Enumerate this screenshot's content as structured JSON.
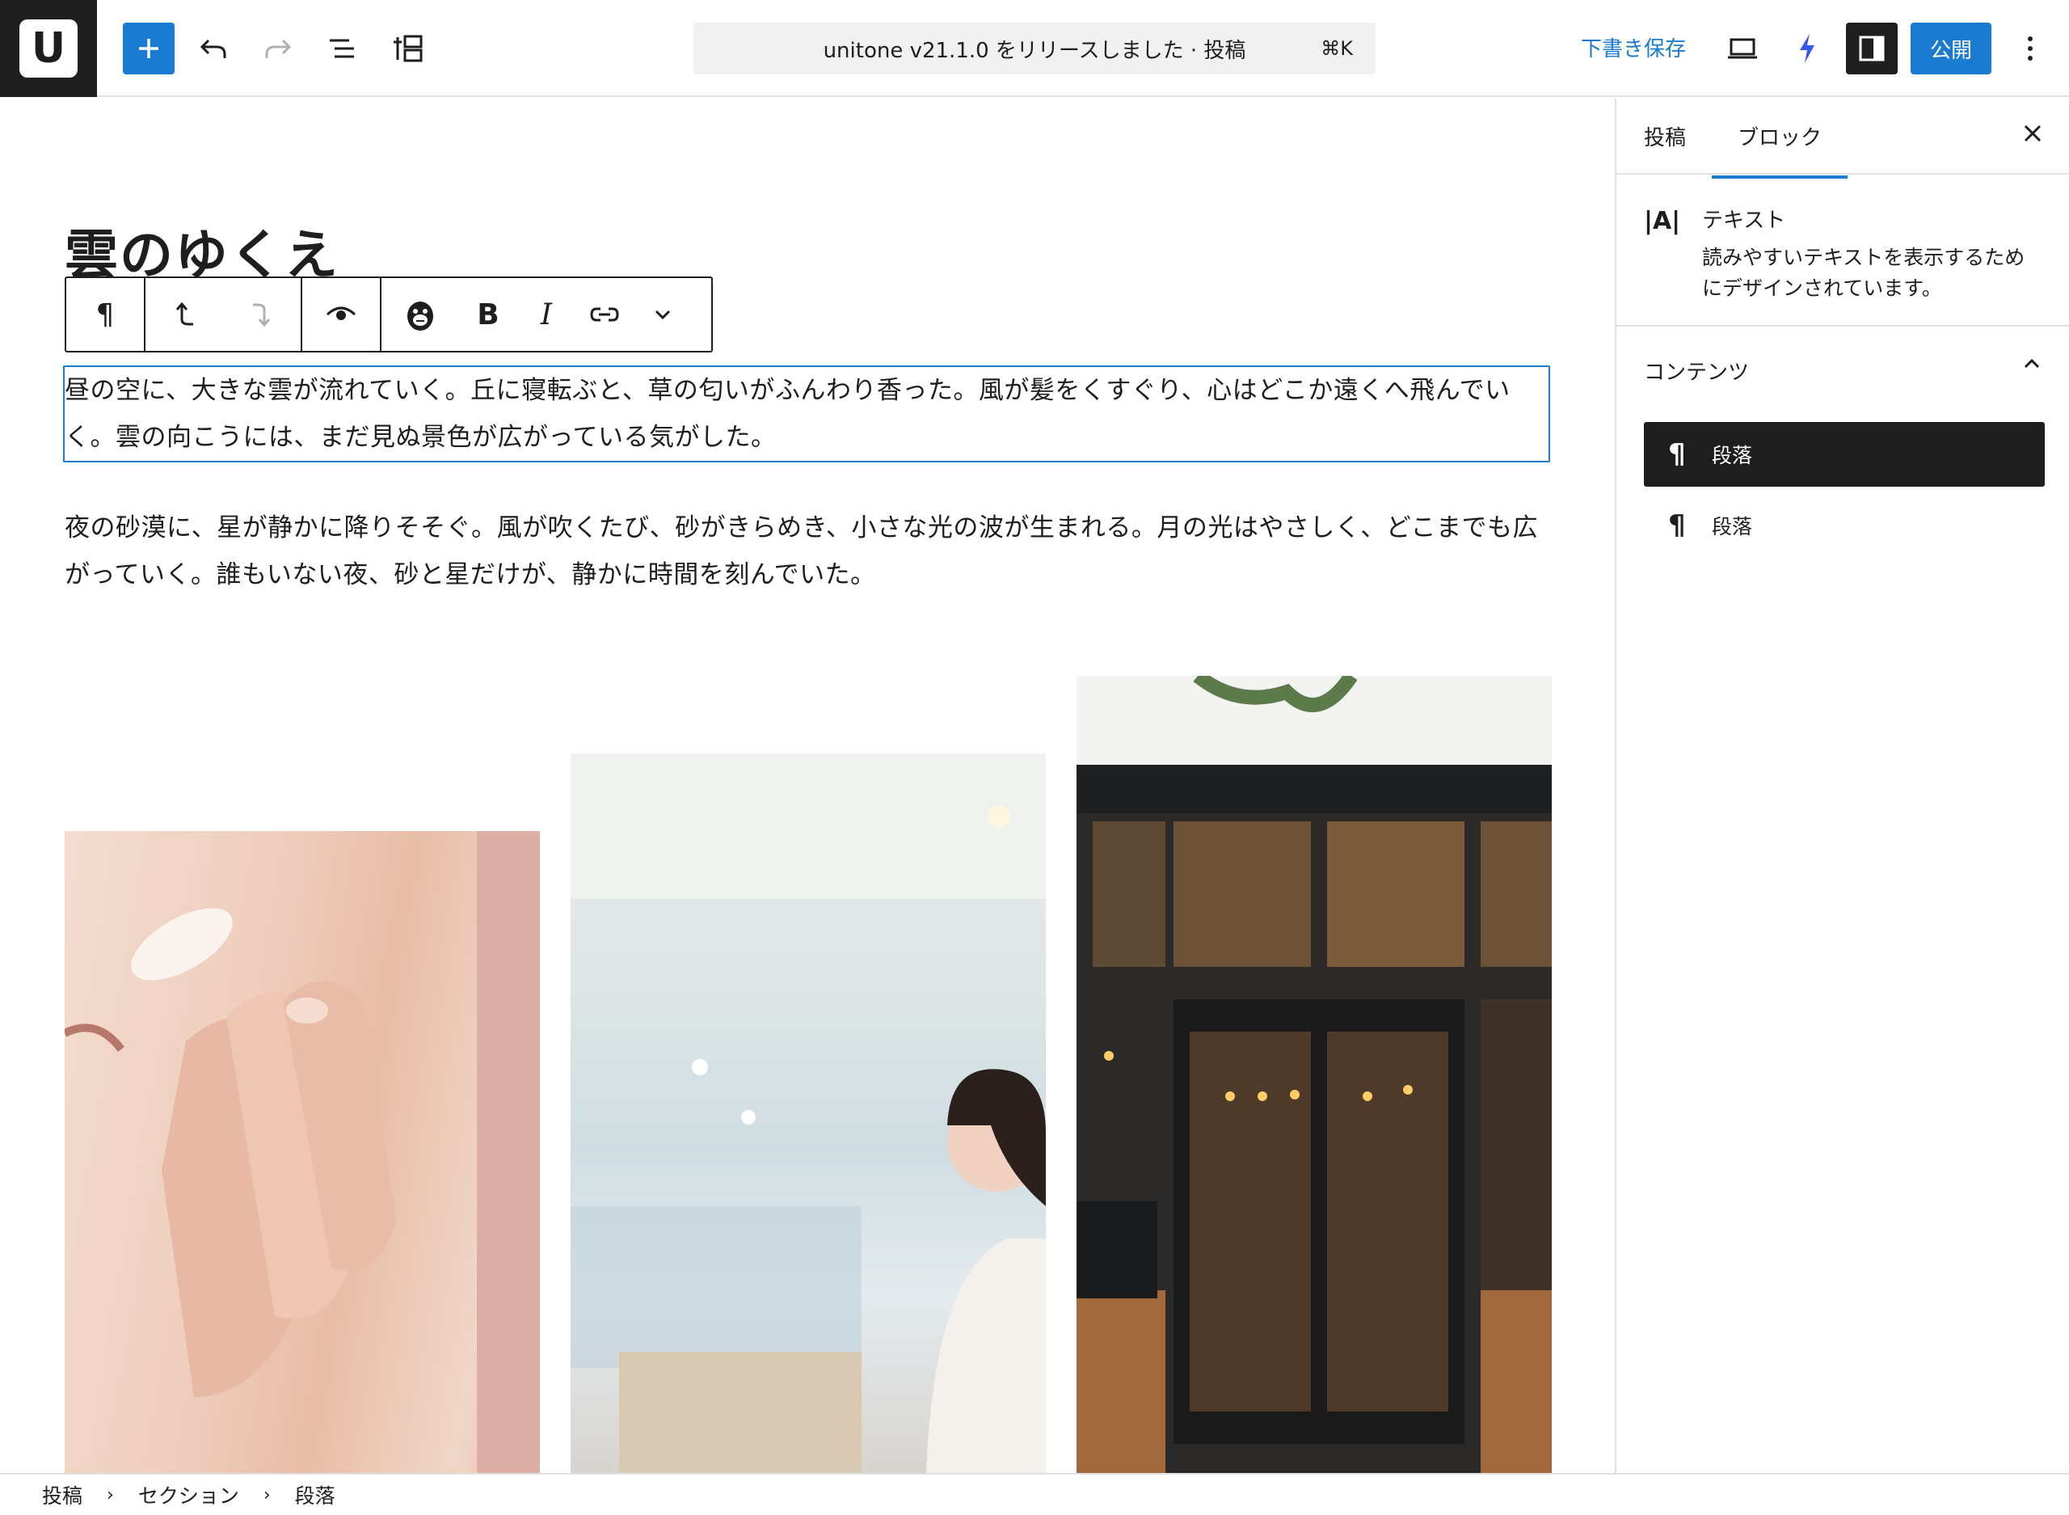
{
  "toolbar": {
    "logo_letter": "U",
    "document_title": "unitone v21.1.0 をリリースしました · 投稿",
    "shortcut": "⌘K",
    "save_draft_label": "下書き保存",
    "publish_label": "公開"
  },
  "post": {
    "title": "雲のゆくえ",
    "paragraphs": [
      "昼の空に、大きな雲が流れていく。丘に寝転ぶと、草の匂いがふんわり香った。風が髪をくすぐり、心はどこか遠くへ飛んでいく。雲の向こうには、まだ見ぬ景色が広がっている気がした。",
      "夜の砂漠に、星が静かに降りそそぐ。風が吹くたび、砂がきらめき、小さな光の波が生まれる。月の光はやさしく、どこまでも広がっていく。誰もいない夜、砂と星だけが、静かに時間を刻んでいた。"
    ]
  },
  "block_toolbar": {
    "paragraph_icon": "¶",
    "bold": "B",
    "italic": "I"
  },
  "sidebar": {
    "tabs": [
      {
        "label": "投稿",
        "active": false
      },
      {
        "label": "ブロック",
        "active": true
      }
    ],
    "block_card": {
      "icon_text": "|A|",
      "title": "テキスト",
      "description": "読みやすいテキストを表示するためにデザインされています。"
    },
    "contents_label": "コンテンツ",
    "content_items": [
      {
        "icon": "¶",
        "label": "段落",
        "selected": true
      },
      {
        "icon": "¶",
        "label": "段落",
        "selected": false
      }
    ]
  },
  "breadcrumb": [
    "投稿",
    "セクション",
    "段落"
  ],
  "colors": {
    "accent": "#1a7bd0",
    "dark": "#1e1e1e",
    "border": "#e0e0e0"
  }
}
